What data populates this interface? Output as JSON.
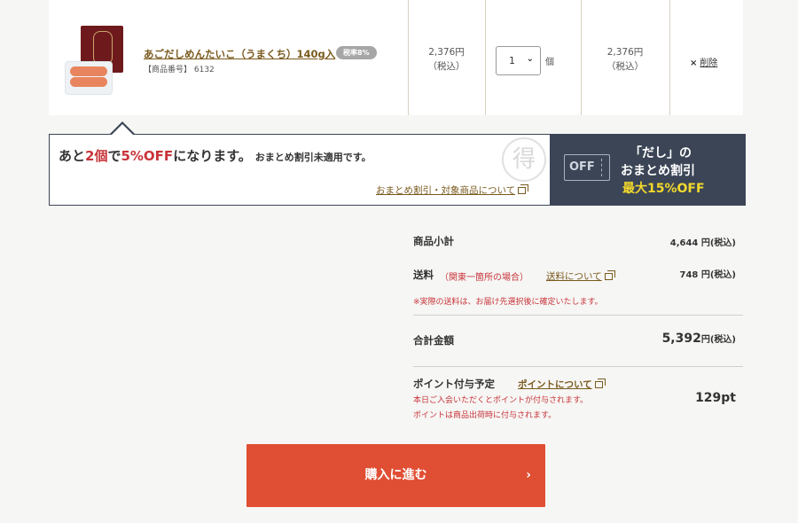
{
  "cart_item": {
    "name": "あごだしめんたいこ（うまくち）140g入",
    "tax_badge": "税率8%",
    "code": "【商品番号】 6132",
    "unit_price": "2,376円",
    "unit_price_note": "（税込）",
    "quantity": "1",
    "quantity_unit": "個",
    "subtotal": "2,376円",
    "subtotal_note": "（税込）",
    "delete_label": "削除"
  },
  "banner": {
    "msg_pre": "あと",
    "msg_count": "2個",
    "msg_mid": "で",
    "msg_discount": "5%OFF",
    "msg_post": "になります。",
    "msg_sub": "おまとめ割引未適用です。",
    "stamp": "得",
    "link": "おまとめ割引・対象商品について",
    "promo_badge": "OFF",
    "promo_line1": "「だし」の",
    "promo_line2": "おまとめ割引",
    "promo_line3": "最大15%OFF"
  },
  "summary": {
    "subtotal_label": "商品小計",
    "subtotal_value": "4,644 円(税込)",
    "shipping_label": "送料",
    "shipping_region": "（関東一箇所の場合）",
    "shipping_link": "送料について",
    "shipping_value": "748 円(税込)",
    "shipping_note": "※実際の送料は、お届け先選択後に確定いたします。",
    "total_label": "合計金額",
    "total_value": "5,392",
    "total_unit": "円(税込)",
    "points_label": "ポイント付与予定",
    "points_link": "ポイントについて",
    "points_note1": "本日ご入会いただくとポイントが付与されます。",
    "points_note2": "ポイントは商品出荷時に付与されます。",
    "points_value": "129pt"
  },
  "buy_button": {
    "label": "購入に進む",
    "arrow": "›"
  },
  "colors": {
    "accent_red": "#e04e33",
    "banner_navy": "#3b4556",
    "link_brown": "#7a5a1e",
    "promo_yellow": "#f4d92b"
  }
}
